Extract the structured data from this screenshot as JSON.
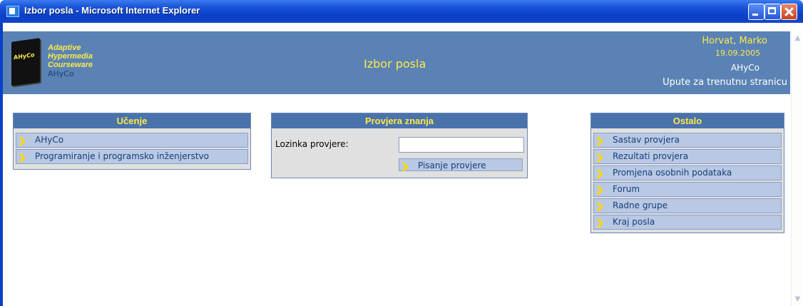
{
  "window": {
    "title": "Izbor posla - Microsoft Internet Explorer"
  },
  "header": {
    "logo": {
      "book_label": "AHyCo",
      "line1": "Adaptive",
      "line2": "Hypermedia",
      "line3": "Courseware",
      "line4": "AHyCo"
    },
    "page_title": "Izbor posla",
    "user_name": "Horvat, Marko",
    "date": "19.09.2005",
    "app_name": "AHyCo",
    "help_link": "Upute za trenutnu stranicu"
  },
  "learning": {
    "title": "Učenje",
    "items": [
      {
        "label": "AHyCo"
      },
      {
        "label": "Programiranje i programsko inženjerstvo"
      }
    ]
  },
  "test": {
    "title": "Provjera znanja",
    "password_label": "Lozinka provjere:",
    "password_value": "",
    "submit_label": "Pisanje provjere"
  },
  "other": {
    "title": "Ostalo",
    "items": [
      {
        "label": "Sastav provjera"
      },
      {
        "label": "Rezultati provjera"
      },
      {
        "label": "Promjena osobnih podataka"
      },
      {
        "label": "Forum"
      },
      {
        "label": "Radne grupe"
      },
      {
        "label": "Kraj posla"
      }
    ]
  },
  "colors": {
    "header_bg": "#5a82b5",
    "panel_head_bg": "#4a73ac",
    "accent_yellow": "#ffe94a",
    "menu_item_bg": "#b9c8e3"
  }
}
